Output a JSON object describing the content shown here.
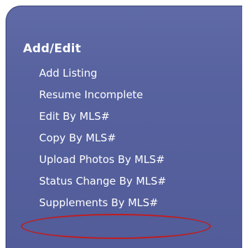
{
  "section": {
    "title": "Add/Edit"
  },
  "menu": {
    "items": [
      {
        "label": "Add Listing"
      },
      {
        "label": "Resume Incomplete"
      },
      {
        "label": "Edit By MLS#"
      },
      {
        "label": "Copy By MLS#"
      },
      {
        "label": "Upload Photos By MLS#"
      },
      {
        "label": "Status Change By MLS#"
      },
      {
        "label": "Supplements By MLS#"
      }
    ]
  },
  "colors": {
    "panel": "#5a65a2",
    "text": "#ffffff",
    "highlight": "#c41a1a"
  }
}
